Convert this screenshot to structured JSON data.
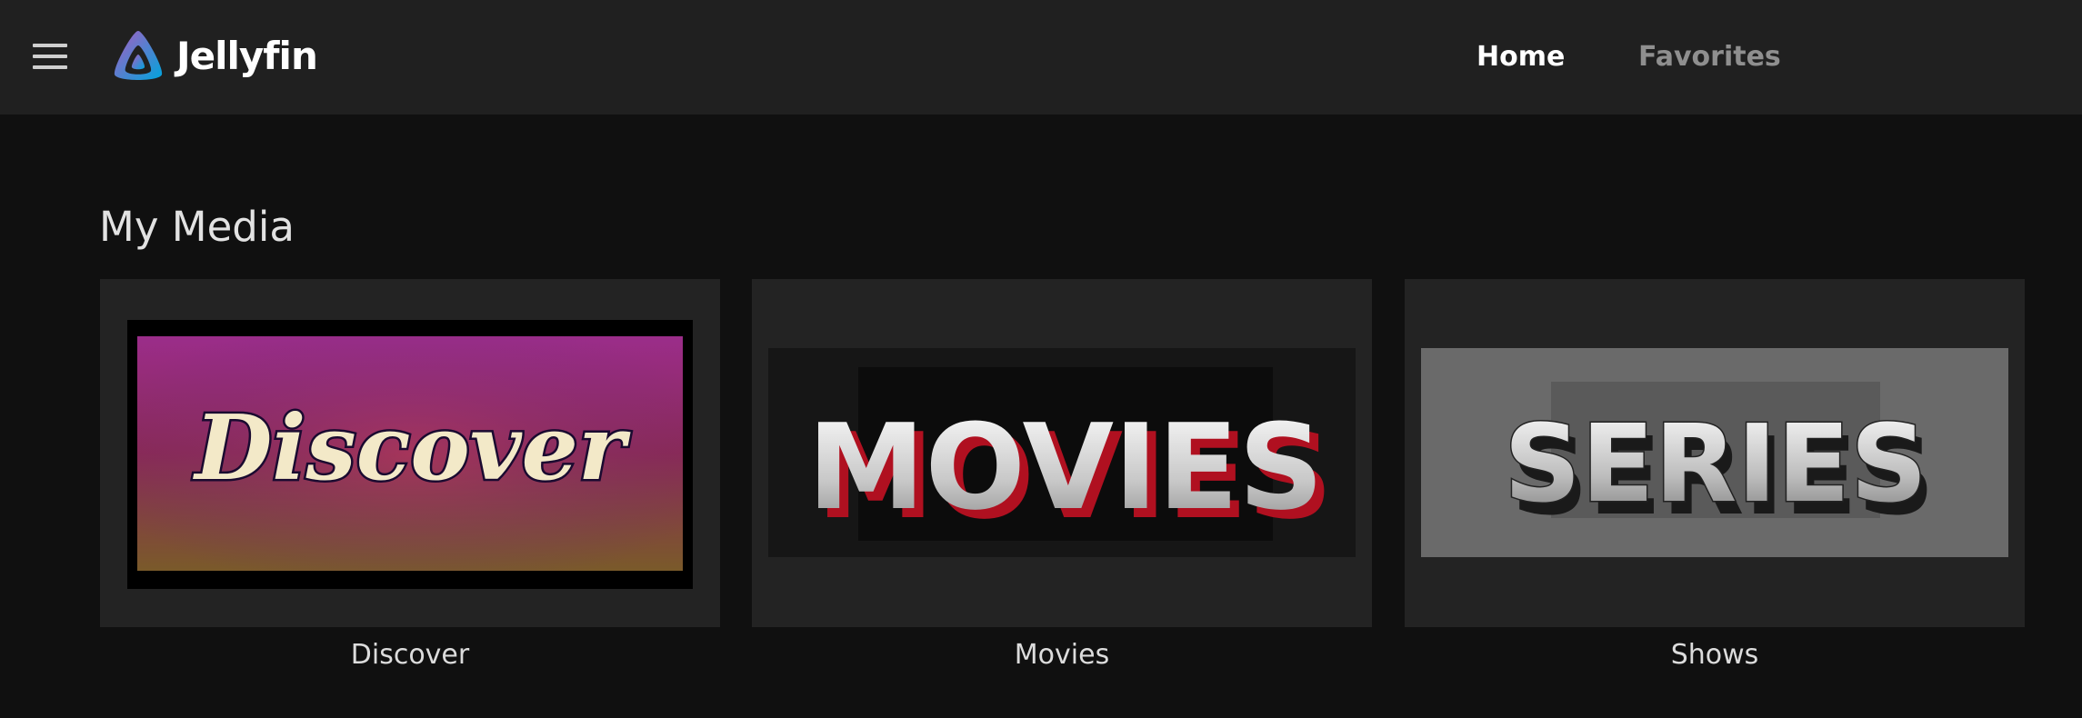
{
  "header": {
    "brand": "Jellyfin",
    "nav": [
      {
        "label": "Home",
        "active": true
      },
      {
        "label": "Favorites",
        "active": false
      }
    ]
  },
  "section": {
    "title": "My Media"
  },
  "libraries": [
    {
      "label": "Discover",
      "thumbnail_text": "Discover"
    },
    {
      "label": "Movies",
      "thumbnail_text": "MOVIES"
    },
    {
      "label": "Shows",
      "thumbnail_text": "SERIES"
    }
  ],
  "colors": {
    "header_bg": "#202020",
    "page_bg": "#101010",
    "card_bg": "#232323",
    "active_nav": "#ffffff",
    "inactive_nav": "#8f8f8f"
  }
}
